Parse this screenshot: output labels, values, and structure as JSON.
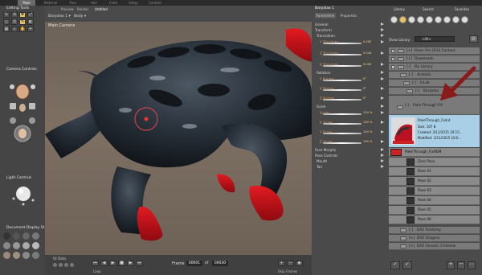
{
  "top_tabs": [
    "Pose",
    "Material",
    "Face",
    "Hair",
    "Cloth",
    "Setup",
    "Content"
  ],
  "editing_tools": {
    "title": "Editing Tools"
  },
  "camera_controls": {
    "title": "Camera Controls"
  },
  "light_controls": {
    "title": "Light Controls"
  },
  "document_display": {
    "title": "Document Display St"
  },
  "viewport": {
    "tabs": [
      "Preview",
      "Render",
      "Untitled"
    ],
    "figure_select": "Baryolax 1",
    "part_select": "Body",
    "camera_label": "Main Camera"
  },
  "bottom": {
    "ui_dots_label": "UI Dots",
    "frame_label": "Frame",
    "frame_current": "00001",
    "frame_of": "of",
    "frame_total": "00030",
    "loop_label": "Loop",
    "skip_frames_label": "Skip Frames"
  },
  "params": {
    "figure_name": "Baryolax 1",
    "tabs": [
      "Parameters",
      "Properties"
    ],
    "rows": [
      {
        "label": "General",
        "kind": "group"
      },
      {
        "label": "Transform",
        "kind": "group"
      },
      {
        "label": "Translation",
        "kind": "sub"
      },
      {
        "label": "Y Translate",
        "kind": "dial",
        "value": "0.000"
      },
      {
        "label": "Z Translate",
        "kind": "dial",
        "value": "0.044"
      },
      {
        "label": "X Translate",
        "kind": "dial",
        "value": "0.000"
      },
      {
        "label": "Rotation",
        "kind": "sub"
      },
      {
        "label": "Y Rotate",
        "kind": "dial",
        "value": "0°"
      },
      {
        "label": "X Rotate",
        "kind": "dial",
        "value": "0°"
      },
      {
        "label": "Z Rotate",
        "kind": "dial",
        "value": "0°"
      },
      {
        "label": "Scale",
        "kind": "sub"
      },
      {
        "label": "Scale",
        "kind": "dial",
        "value": "100 %"
      },
      {
        "label": "X Scale",
        "kind": "dial",
        "value": "100 %"
      },
      {
        "label": "Y Scale",
        "kind": "dial",
        "value": "100 %"
      },
      {
        "label": "Z Scale",
        "kind": "dial",
        "value": "100 %"
      },
      {
        "label": "Face Morphs",
        "kind": "group"
      },
      {
        "label": "Pose Controls",
        "kind": "group"
      },
      {
        "label": "Mouth",
        "kind": "group"
      },
      {
        "label": "Tail",
        "kind": "group"
      }
    ]
  },
  "library": {
    "tabs": [
      "Library",
      "Search",
      "Favorites"
    ],
    "show_label": "Show Library:",
    "show_value": "<All>",
    "rows": [
      {
        "badge": "[+]",
        "label": "Poser Pro 2014 Content",
        "depth": 0
      },
      {
        "badge": "[+]",
        "label": "Downloads",
        "depth": 0
      },
      {
        "badge": "[-]",
        "label": "My Library",
        "depth": 0
      },
      {
        "badge": "[-]",
        "label": "Animals",
        "depth": 1
      },
      {
        "badge": "[-]",
        "label": "InLab",
        "depth": 2
      },
      {
        "badge": "[-]",
        "label": "Baryolax",
        "depth": 3
      },
      {
        "badge": "[-]",
        "label": "Poke-Through FIX",
        "depth": 4
      }
    ],
    "selected": {
      "name": "PokeThrough_FixInt",
      "size": "Size: 107 B",
      "created": "Created: 3/11/2015 10:15...",
      "modified": "Modified: 3/11/2015 10:0..."
    },
    "poses": [
      "PokeThrough_FixREM",
      "Zero Pose",
      "Pose 01",
      "Pose 02",
      "Pose 03",
      "Pose 04",
      "Pose 05",
      "Pose 06"
    ],
    "more_rows": [
      {
        "badge": "[-]",
        "label": "DAZ Anatomy"
      },
      {
        "badge": "[+]",
        "label": "DAZ Dragons"
      },
      {
        "badge": "[+]",
        "label": "DAZ Genesis 3 Female"
      }
    ]
  },
  "colors": {
    "accent": "#e8c25a",
    "selected": "#a8cfe6",
    "arrow": "#8b1a1a",
    "skin_red": "#d1121a"
  }
}
